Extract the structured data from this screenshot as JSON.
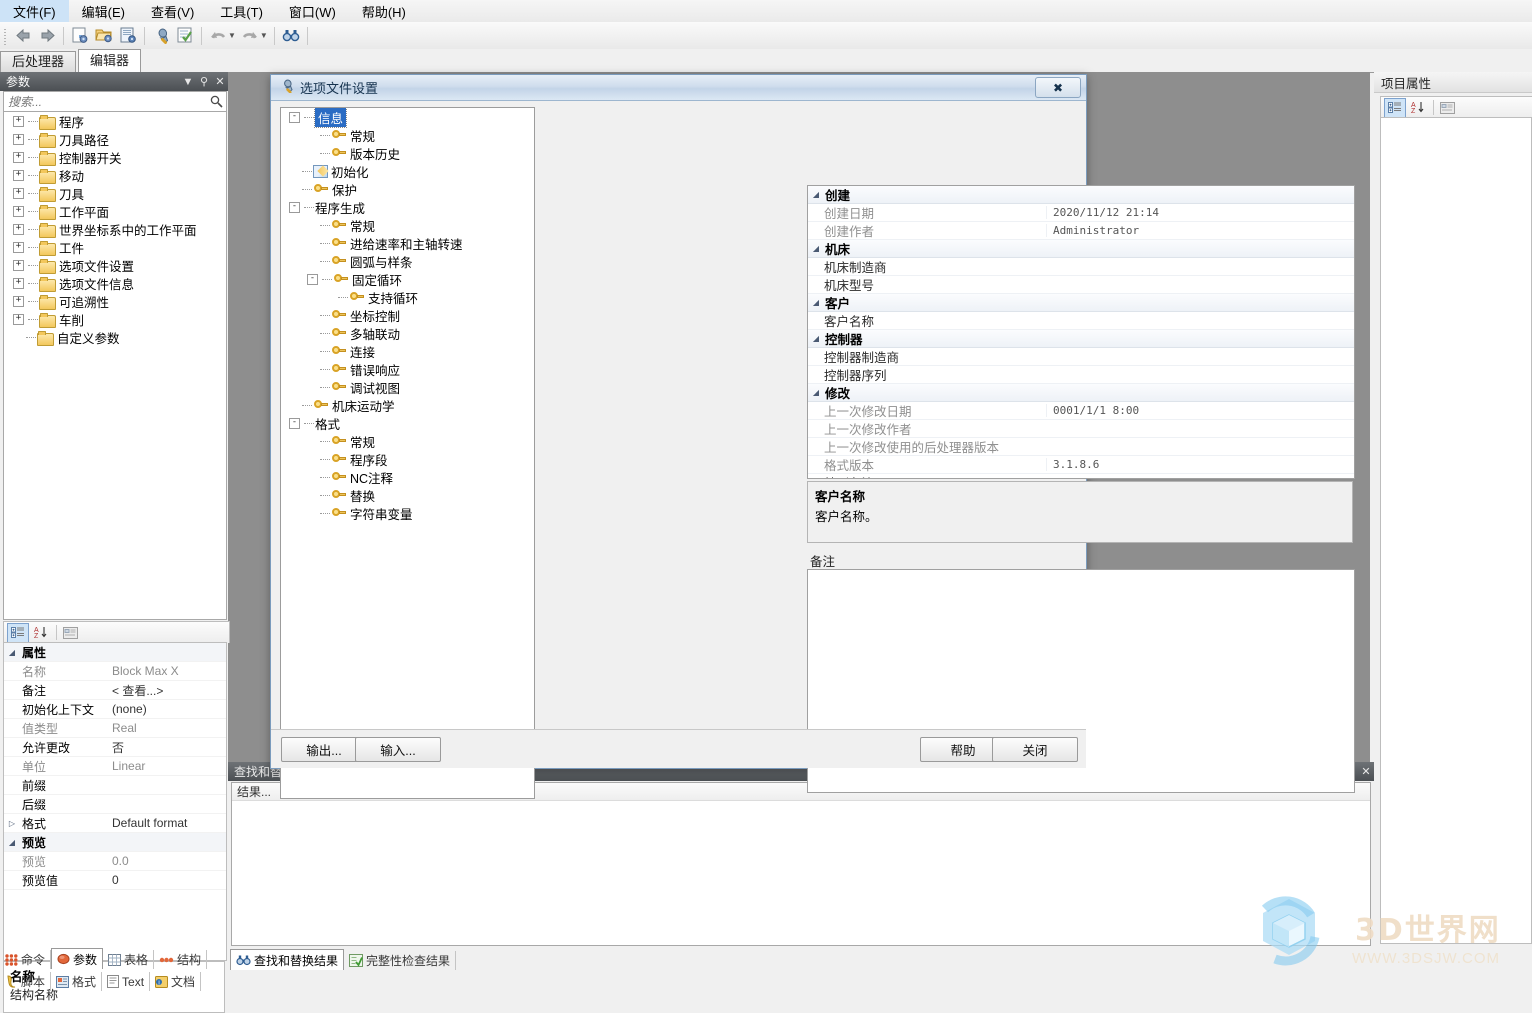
{
  "menu": {
    "items": [
      {
        "label": "文件(F)"
      },
      {
        "label": "编辑(E)"
      },
      {
        "label": "查看(V)"
      },
      {
        "label": "工具(T)"
      },
      {
        "label": "窗口(W)"
      },
      {
        "label": "帮助(H)"
      }
    ]
  },
  "toolbar": {
    "icons": [
      {
        "name": "back-arrow-icon"
      },
      {
        "name": "forward-arrow-icon"
      },
      {
        "name": "new-document-icon"
      },
      {
        "name": "open-folder-icon"
      },
      {
        "name": "save-icon"
      },
      {
        "name": "wrench-icon"
      },
      {
        "name": "verify-icon"
      },
      {
        "name": "undo-icon"
      },
      {
        "name": "redo-icon"
      },
      {
        "name": "find-binoculars-icon"
      }
    ]
  },
  "main_tabs": [
    {
      "label": "后处理器",
      "active": false
    },
    {
      "label": "编辑器",
      "active": true
    }
  ],
  "left_panel": {
    "title": "参数",
    "search_placeholder": "搜索...",
    "tree": [
      {
        "label": "程序",
        "expandable": true
      },
      {
        "label": "刀具路径",
        "expandable": true
      },
      {
        "label": "控制器开关",
        "expandable": true
      },
      {
        "label": "移动",
        "expandable": true
      },
      {
        "label": "刀具",
        "expandable": true
      },
      {
        "label": "工作平面",
        "expandable": true
      },
      {
        "label": "世界坐标系中的工作平面",
        "expandable": true
      },
      {
        "label": "工件",
        "expandable": true
      },
      {
        "label": "选项文件设置",
        "expandable": true
      },
      {
        "label": "选项文件信息",
        "expandable": true
      },
      {
        "label": "可追溯性",
        "expandable": true
      },
      {
        "label": "车削",
        "expandable": true
      },
      {
        "label": "自定义参数",
        "expandable": false
      }
    ],
    "property_grid": {
      "rows": [
        {
          "type": "category",
          "label": "属性",
          "exp": "◢"
        },
        {
          "type": "prop",
          "key": "名称",
          "value": "Block Max X",
          "key_dim": true,
          "value_dim": true
        },
        {
          "type": "prop",
          "key": "备注",
          "value": "< 查看...>",
          "key_dim": false,
          "value_dim": false
        },
        {
          "type": "prop",
          "key": "初始化上下文",
          "value": "(none)",
          "key_dim": false,
          "value_dim": false
        },
        {
          "type": "prop",
          "key": "值类型",
          "value": "Real",
          "key_dim": true,
          "value_dim": true
        },
        {
          "type": "prop",
          "key": "允许更改",
          "value": "否",
          "key_dim": false,
          "value_dim": false
        },
        {
          "type": "prop",
          "key": "单位",
          "value": "Linear",
          "key_dim": true,
          "value_dim": true
        },
        {
          "type": "prop",
          "key": "前缀",
          "value": "",
          "key_dim": false,
          "value_dim": false
        },
        {
          "type": "prop",
          "key": "后缀",
          "value": "",
          "key_dim": false,
          "value_dim": false
        },
        {
          "type": "prop",
          "key": "格式",
          "value": "Default format",
          "exp": "▷",
          "key_dim": false,
          "value_dim": false
        },
        {
          "type": "category",
          "label": "预览",
          "exp": "◢"
        },
        {
          "type": "prop",
          "key": "预览",
          "value": "0.0",
          "key_dim": true,
          "value_dim": true
        },
        {
          "type": "prop",
          "key": "预览值",
          "value": "0",
          "key_dim": false,
          "value_dim": false
        }
      ],
      "description_title": "名称",
      "description_text": "结构名称"
    },
    "tabs_row1": [
      {
        "label": "命令",
        "icon": "commands-icon",
        "active": false
      },
      {
        "label": "参数",
        "icon": "parameters-icon",
        "active": true
      },
      {
        "label": "表格",
        "icon": "tables-icon",
        "active": false
      },
      {
        "label": "结构",
        "icon": "structures-icon",
        "active": false
      }
    ],
    "tabs_row2": [
      {
        "label": "脚本",
        "icon": "script-icon",
        "active": false
      },
      {
        "label": "格式",
        "icon": "format-icon",
        "active": false
      },
      {
        "label": "Text",
        "icon": "text-icon",
        "active": false
      },
      {
        "label": "文档",
        "icon": "document-icon",
        "active": false
      }
    ]
  },
  "right_panel": {
    "title": "项目属性",
    "toolbar_icons": [
      {
        "name": "categorized-view-icon",
        "selected": true
      },
      {
        "name": "alphabetical-sort-icon",
        "selected": false
      },
      {
        "name": "property-pages-icon",
        "selected": false
      }
    ]
  },
  "bottom_dock": {
    "title": "查找和替换结果",
    "column_header": "结果...",
    "tabs": [
      {
        "label": "查找和替换结果",
        "icon": "find-binoculars-icon",
        "active": true
      },
      {
        "label": "完整性检查结果",
        "icon": "checklist-icon",
        "active": false
      }
    ]
  },
  "dialog": {
    "title": "选项文件设置",
    "close_label": "✖",
    "tree": [
      {
        "label": "信息",
        "indent": 0,
        "icon": "expand-box",
        "expander": "-",
        "selected": true
      },
      {
        "label": "常规",
        "indent": 1,
        "icon": "key-icon"
      },
      {
        "label": "版本历史",
        "indent": 1,
        "icon": "key-icon"
      },
      {
        "label": "初始化",
        "indent": 0,
        "icon": "pencil-icon"
      },
      {
        "label": "保护",
        "indent": 0,
        "icon": "key-icon"
      },
      {
        "label": "程序生成",
        "indent": 0,
        "icon": "none",
        "expander": "-"
      },
      {
        "label": "常规",
        "indent": 1,
        "icon": "key-icon"
      },
      {
        "label": "进给速率和主轴转速",
        "indent": 1,
        "icon": "key-icon"
      },
      {
        "label": "圆弧与样条",
        "indent": 1,
        "icon": "key-icon"
      },
      {
        "label": "固定循环",
        "indent": 1,
        "icon": "key-icon",
        "expander": "-"
      },
      {
        "label": "支持循环",
        "indent": 2,
        "icon": "key-icon"
      },
      {
        "label": "坐标控制",
        "indent": 1,
        "icon": "key-icon"
      },
      {
        "label": "多轴联动",
        "indent": 1,
        "icon": "key-icon"
      },
      {
        "label": "连接",
        "indent": 1,
        "icon": "key-icon"
      },
      {
        "label": "错误响应",
        "indent": 1,
        "icon": "key-icon"
      },
      {
        "label": "调试视图",
        "indent": 1,
        "icon": "key-icon"
      },
      {
        "label": "机床运动学",
        "indent": 0,
        "icon": "key-icon"
      },
      {
        "label": "格式",
        "indent": 0,
        "icon": "none",
        "expander": "-"
      },
      {
        "label": "常规",
        "indent": 1,
        "icon": "key-icon"
      },
      {
        "label": "程序段",
        "indent": 1,
        "icon": "key-icon"
      },
      {
        "label": "NC注释",
        "indent": 1,
        "icon": "key-icon"
      },
      {
        "label": "替换",
        "indent": 1,
        "icon": "key-icon"
      },
      {
        "label": "字符串变量",
        "indent": 1,
        "icon": "key-icon"
      }
    ],
    "grid": [
      {
        "type": "category",
        "label": "创建"
      },
      {
        "type": "prop",
        "key": "创建日期",
        "value": "2020/11/12 21:14",
        "key_dim": true
      },
      {
        "type": "prop",
        "key": "创建作者",
        "value": "Administrator",
        "key_dim": true
      },
      {
        "type": "category",
        "label": "机床"
      },
      {
        "type": "prop",
        "key": "机床制造商",
        "value": "",
        "key_dim": false
      },
      {
        "type": "prop",
        "key": "机床型号",
        "value": "",
        "key_dim": false
      },
      {
        "type": "category",
        "label": "客户"
      },
      {
        "type": "prop",
        "key": "客户名称",
        "value": "",
        "key_dim": false,
        "selected": true
      },
      {
        "type": "category",
        "label": "控制器"
      },
      {
        "type": "prop",
        "key": "控制器制造商",
        "value": "",
        "key_dim": false
      },
      {
        "type": "prop",
        "key": "控制器序列",
        "value": "",
        "key_dim": false
      },
      {
        "type": "category",
        "label": "修改"
      },
      {
        "type": "prop",
        "key": "上一次修改日期",
        "value": "0001/1/1 8:00",
        "key_dim": true
      },
      {
        "type": "prop",
        "key": "上一次修改作者",
        "value": "",
        "key_dim": true
      },
      {
        "type": "prop",
        "key": "上一次修改使用的后处理器版本",
        "value": "",
        "key_dim": true
      },
      {
        "type": "prop",
        "key": "格式版本",
        "value": "3.1.8.6",
        "key_dim": true
      },
      {
        "type": "prop",
        "key": "特别备注",
        "value": "",
        "key_dim": false
      }
    ],
    "help_title": "客户名称",
    "help_text": "客户名称。",
    "note_label": "备注",
    "note_value": "",
    "buttons": {
      "export": "输出...",
      "import": "输入...",
      "help": "帮助",
      "close": "关闭"
    }
  },
  "watermark": {
    "text": "3D世界网",
    "url": "WWW.3DSJW.COM"
  }
}
